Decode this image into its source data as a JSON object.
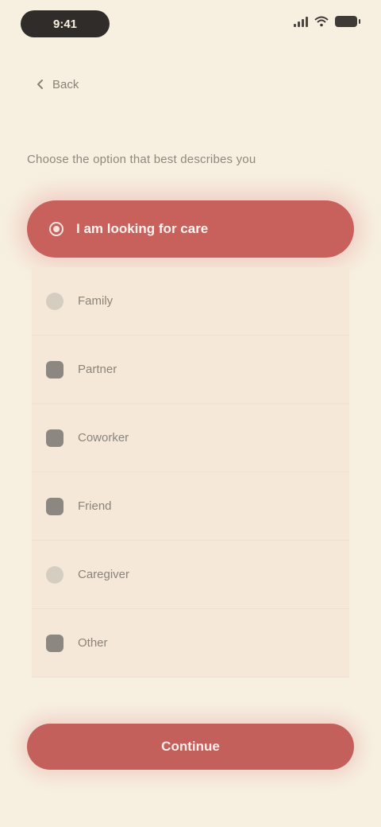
{
  "status_bar": {
    "time": "9:41",
    "icons": [
      "signal-icon",
      "wifi-icon",
      "battery-icon"
    ]
  },
  "nav": {
    "back_label": "Back",
    "back_icon": "chevron-left-icon"
  },
  "heading": "Choose the option that best describes you",
  "primary_option": {
    "label": "I am looking for care",
    "selected": true
  },
  "options": [
    {
      "label": "Family",
      "icon": "family-icon"
    },
    {
      "label": "Partner",
      "icon": "partner-icon"
    },
    {
      "label": "Coworker",
      "icon": "coworker-icon"
    },
    {
      "label": "Friend",
      "icon": "friend-icon"
    },
    {
      "label": "Caregiver",
      "icon": "caregiver-icon"
    },
    {
      "label": "Other",
      "icon": "other-icon"
    }
  ],
  "submit_button": {
    "label": "Continue"
  },
  "colors": {
    "background": "#f7f0e1",
    "accent": "#c8605c",
    "list_row": "#f5e8d8",
    "muted_text": "#8b847a"
  }
}
